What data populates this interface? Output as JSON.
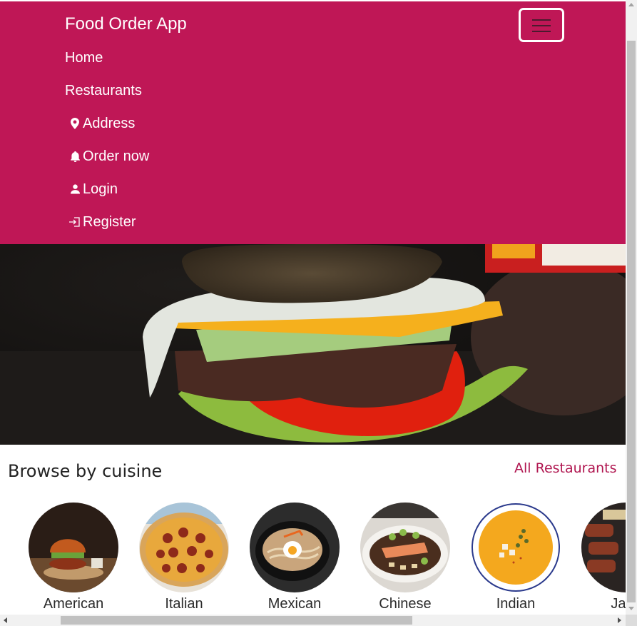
{
  "colors": {
    "navbar_bg": "#bf1756",
    "accent_link": "#b01650",
    "text_dark": "#222222"
  },
  "navbar": {
    "brand": "Food Order App",
    "toggler_icon": "hamburger-icon",
    "items": [
      {
        "label": "Home",
        "icon": ""
      },
      {
        "label": "Restaurants",
        "icon": ""
      },
      {
        "label": "Address",
        "icon": "map-marker-icon"
      },
      {
        "label": "Order now",
        "icon": "bell-icon"
      },
      {
        "label": "Login",
        "icon": "person-icon"
      },
      {
        "label": "Register",
        "icon": "box-arrow-in-icon"
      }
    ]
  },
  "hero": {
    "image": "burger-photo"
  },
  "browse": {
    "title": "Browse by cuisine",
    "all_link": "All Restaurants",
    "cuisines": [
      {
        "label": "American",
        "image": "burger-plate"
      },
      {
        "label": "Italian",
        "image": "pepperoni-pizza"
      },
      {
        "label": "Mexican",
        "image": "noodle-bowl"
      },
      {
        "label": "Chinese",
        "image": "fish-dish"
      },
      {
        "label": "Indian",
        "image": "soup-bowl"
      },
      {
        "label": "Japa",
        "image": "grilled-meat"
      }
    ]
  }
}
